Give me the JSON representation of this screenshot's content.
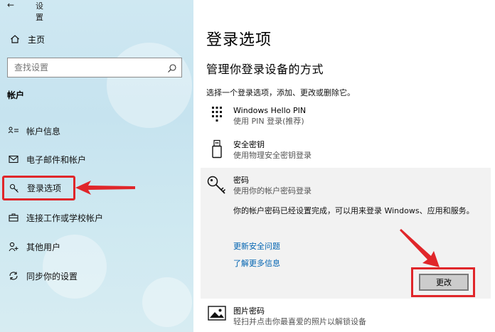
{
  "window": {
    "title": "设置",
    "back_glyph": "←"
  },
  "sidebar": {
    "home_label": "主页",
    "search": {
      "placeholder": "查找设置"
    },
    "section": "帐户",
    "items": [
      {
        "label": "帐户信息",
        "icon": "person-card-icon"
      },
      {
        "label": "电子邮件和帐户",
        "icon": "mail-icon"
      },
      {
        "label": "登录选项",
        "icon": "key-icon",
        "active": true
      },
      {
        "label": "连接工作或学校帐户",
        "icon": "briefcase-icon"
      },
      {
        "label": "其他用户",
        "icon": "person-add-icon"
      },
      {
        "label": "同步你的设置",
        "icon": "sync-icon"
      }
    ]
  },
  "main": {
    "title": "登录选项",
    "subtitle": "管理你登录设备的方式",
    "instruction": "选择一个登录选项，添加、更改或删除它。",
    "options": [
      {
        "title": "Windows Hello PIN",
        "desc": "使用 PIN 登录(推荐)",
        "icon": "keypad-icon"
      },
      {
        "title": "安全密钥",
        "desc": "使用物理安全密钥登录",
        "icon": "usb-key-icon"
      }
    ],
    "password": {
      "title": "密码",
      "desc": "使用你的帐户密码登录",
      "icon": "key-icon",
      "message": "你的帐户密码已经设置完成，可以用来登录 Windows、应用和服务。",
      "link_update": "更新安全问题",
      "link_more": "了解更多信息",
      "change_label": "更改"
    },
    "picture": {
      "title": "图片密码",
      "desc": "轻扫并点击你最喜爱的照片以解锁设备",
      "icon": "picture-icon"
    }
  },
  "colors": {
    "highlight": "#e0262a",
    "link": "#0063b1",
    "sidebar_bg": "#c6e3ef"
  }
}
